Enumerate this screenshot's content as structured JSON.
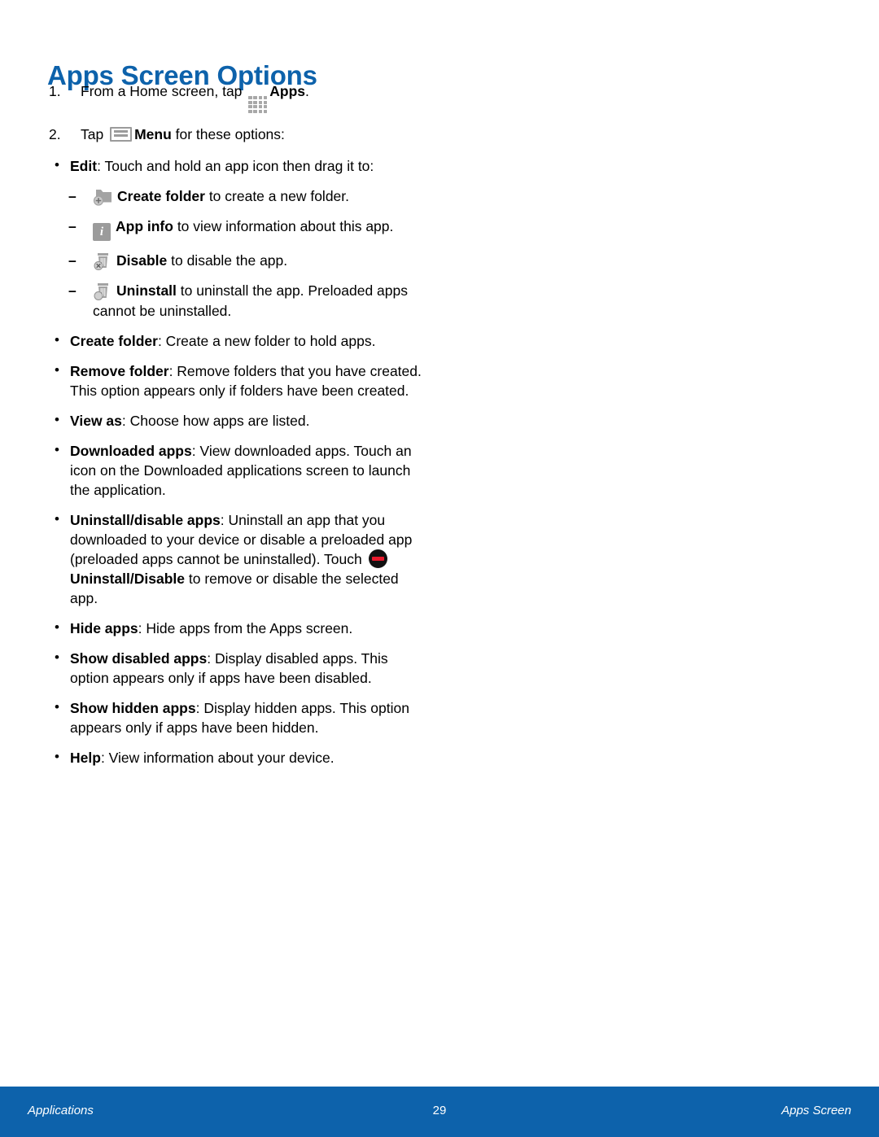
{
  "document": {
    "title": "Apps Screen Options"
  },
  "steps": [
    {
      "num": "1.",
      "pre": "From a Home screen, tap ",
      "icon": "apps-grid-icon",
      "bold": "Apps",
      "post": "."
    },
    {
      "num": "2.",
      "pre": "Tap ",
      "icon": "menu-icon",
      "bold": "Menu",
      "post": " for these options:"
    }
  ],
  "edit_bullet": {
    "bold": "Edit",
    "text": ": Touch and hold an app icon then drag it to:"
  },
  "subitems": [
    {
      "icon": "create-folder-icon",
      "bold": "Create folder",
      "text": " to create a new folder."
    },
    {
      "icon": "app-info-icon",
      "bold": "App info",
      "text": " to view information about this app."
    },
    {
      "icon": "disable-trash-icon",
      "bold": "Disable",
      "text": " to disable the app."
    },
    {
      "icon": "uninstall-trash-icon",
      "bold": "Uninstall",
      "text": " to uninstall the app. Preloaded apps cannot be uninstalled."
    }
  ],
  "bullets": [
    {
      "bold": "Create folder",
      "text": ": Create a new folder to hold apps."
    },
    {
      "bold": "Remove folder",
      "text": ": Remove folders that you have created. This option appears only if folders have been created."
    },
    {
      "bold": "View as",
      "text": ": Choose how apps are listed."
    },
    {
      "bold": "Downloaded apps",
      "text": ": View downloaded apps. Touch an icon on the Downloaded applications screen to launch the application."
    }
  ],
  "uninstall_disable_bullet": {
    "bold": "Uninstall/disable apps",
    "text_before": ": Uninstall an app that you downloaded to your device or disable a preloaded app (preloaded apps cannot be uninstalled). Touch ",
    "icon": "uninstall-disable-icon",
    "bold2": "Uninstall/Disable",
    "text_after": " to remove or disable the selected app."
  },
  "bullets_tail": [
    {
      "bold": "Hide apps",
      "text": ": Hide apps from the Apps screen."
    },
    {
      "bold": "Show disabled apps",
      "text": ": Display disabled apps. This option appears only if apps have been disabled."
    },
    {
      "bold": "Show hidden apps",
      "text": ": Display hidden apps. This option appears only if apps have been hidden."
    },
    {
      "bold": "Help",
      "text": ": View information about your device."
    }
  ],
  "footer": {
    "left": "Applications",
    "page_number": "29",
    "right": "Apps Screen"
  },
  "colors": {
    "accent_blue": "#0d62ab",
    "icon_gray": "#9b9b9b",
    "red": "#e8192c"
  }
}
